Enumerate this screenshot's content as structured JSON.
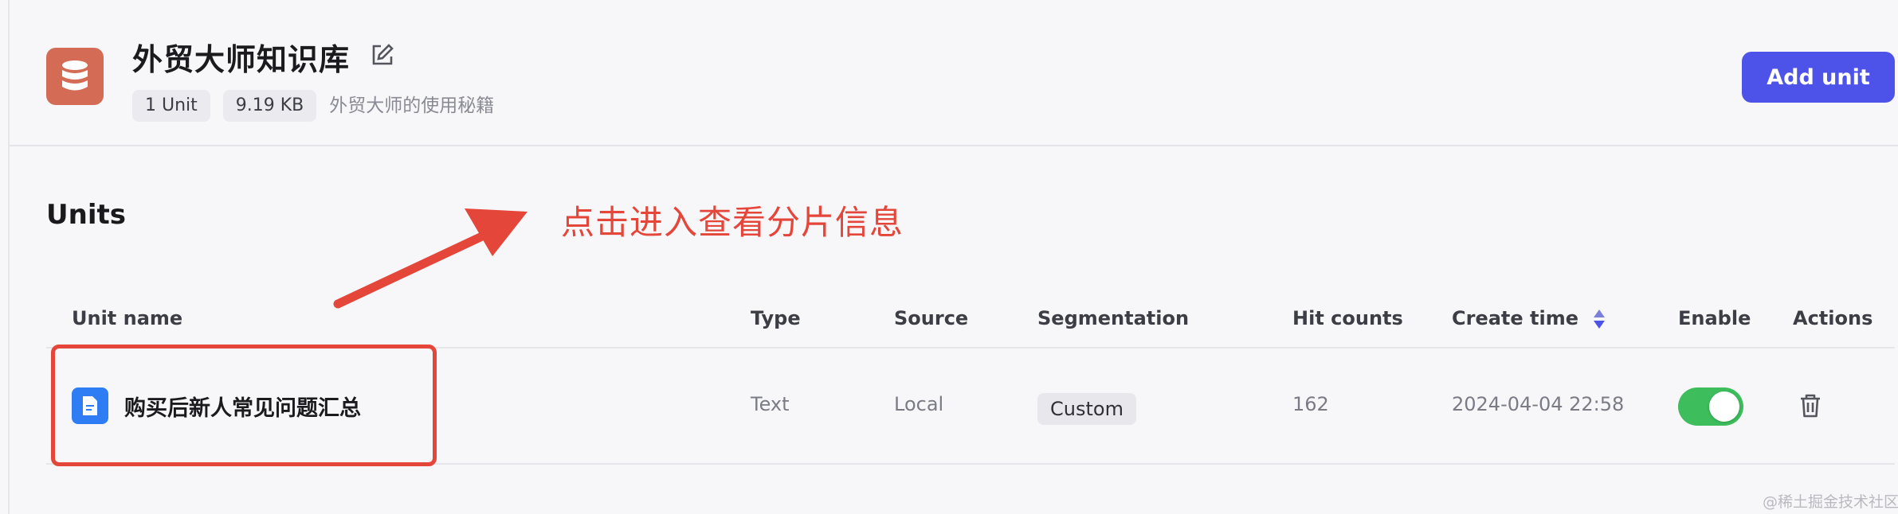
{
  "header": {
    "kb_title": "外贸大师知识库",
    "tags": [
      "1 Unit",
      "9.19 KB"
    ],
    "description": "外贸大师的使用秘籍",
    "add_button": "Add unit",
    "icons": {
      "logo": "database-icon",
      "edit": "edit-icon"
    }
  },
  "section": {
    "title": "Units"
  },
  "annotation": {
    "text": "点击进入查看分片信息",
    "color": "#e5463a"
  },
  "table": {
    "columns": [
      "Unit name",
      "Type",
      "Source",
      "Segmentation",
      "Hit counts",
      "Create time",
      "Enable",
      "Actions"
    ],
    "rows": [
      {
        "name": "购买后新人常见问题汇总",
        "type": "Text",
        "source": "Local",
        "segmentation": "Custom",
        "hit_counts": "162",
        "create_time": "2024-04-04 22:58",
        "enabled": true
      }
    ]
  },
  "watermark": "@稀土掘金技术社区",
  "colors": {
    "accent": "#4d53e8",
    "toggle_on": "#3dbd5c",
    "logo_bg": "#d36b55",
    "doc_icon": "#2f7df4"
  }
}
